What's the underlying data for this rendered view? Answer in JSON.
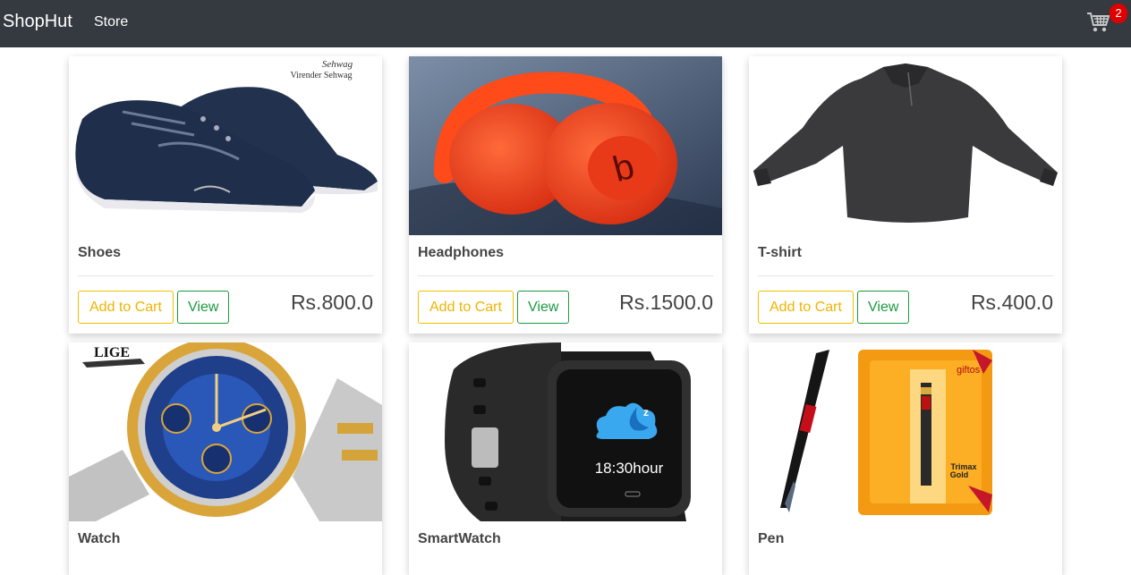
{
  "nav": {
    "brand": "ShopHut",
    "store_link": "Store",
    "cart_count": "2"
  },
  "products": [
    {
      "title": "Shoes",
      "price": "Rs.800.0",
      "add_to_cart": "Add to Cart",
      "view": "View",
      "image_text": "Virender Sehwag"
    },
    {
      "title": "Headphones",
      "price": "Rs.1500.0",
      "add_to_cart": "Add to Cart",
      "view": "View"
    },
    {
      "title": "T-shirt",
      "price": "Rs.400.0",
      "add_to_cart": "Add to Cart",
      "view": "View"
    },
    {
      "title": "Watch",
      "image_text": "LIGE"
    },
    {
      "title": "SmartWatch",
      "image_text": "18:30hour"
    },
    {
      "title": "Pen",
      "image_text": "giftos"
    }
  ],
  "colors": {
    "navbar": "#343a40",
    "add_to_cart": "#f0b400",
    "view": "#1a9a40",
    "badge": "#e00000"
  }
}
